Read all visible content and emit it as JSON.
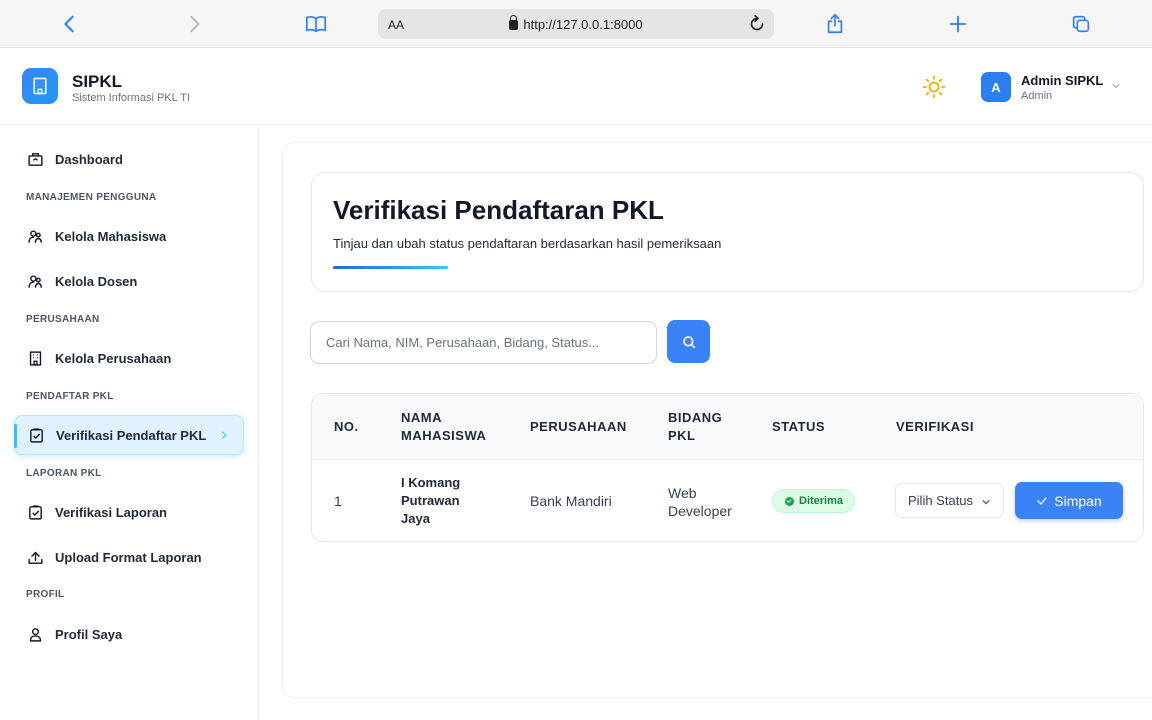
{
  "browser": {
    "aa_label": "AA",
    "url": "http://127.0.0.1:8000"
  },
  "app": {
    "name": "SIPKL",
    "subtitle": "Sistem Informasi PKL TI"
  },
  "user": {
    "initial": "A",
    "name": "Admin SIPKL",
    "role": "Admin"
  },
  "sidebar": {
    "dashboard": "Dashboard",
    "section_pengguna": "MANAJEMEN PENGGUNA",
    "mahasiswa": "Kelola Mahasiswa",
    "dosen": "Kelola Dosen",
    "section_perusahaan": "PERUSAHAAN",
    "perusahaan": "Kelola Perusahaan",
    "section_pendaftar": "PENDAFTAR PKL",
    "verifikasi_pendaftar": "Verifikasi Pendaftar PKL",
    "section_laporan": "LAPORAN PKL",
    "verifikasi_laporan": "Verifikasi Laporan",
    "upload_format": "Upload Format Laporan",
    "section_profil": "PROFIL",
    "profil": "Profil Saya"
  },
  "page": {
    "title": "Verifikasi Pendaftaran PKL",
    "subtitle": "Tinjau dan ubah status pendaftaran berdasarkan hasil pemeriksaan"
  },
  "search": {
    "placeholder": "Cari Nama, NIM, Perusahaan, Bidang, Status..."
  },
  "table": {
    "headers": {
      "no": "NO.",
      "nama_line1": "NAMA",
      "nama_line2": "MAHASISWA",
      "perusahaan": "PERUSAHAAN",
      "bidang_line1": "BIDANG",
      "bidang_line2": "PKL",
      "status": "STATUS",
      "verifikasi": "VERIFIKASI"
    },
    "rows": [
      {
        "no": "1",
        "nama_line1": "I Komang",
        "nama_line2": "Putrawan",
        "nama_line3": "Jaya",
        "perusahaan": "Bank Mandiri",
        "bidang_line1": "Web",
        "bidang_line2": "Developer",
        "status": "Diterima",
        "select_value": "Pilih Status",
        "save_label": "Simpan"
      }
    ]
  },
  "colors": {
    "accent": "#3b82f6",
    "status_success": "#16a34a",
    "active_nav_bg": "#e0f2fe"
  },
  "icons": [
    "back-icon",
    "forward-icon",
    "bookmarks-icon",
    "reload-icon",
    "share-icon",
    "new-tab-icon",
    "tabs-icon",
    "building-icon",
    "sun-icon",
    "chevron-down-icon",
    "dashboard-icon",
    "users-icon",
    "office-icon",
    "check-doc-icon",
    "upload-icon",
    "user-icon",
    "search-icon",
    "check-icon"
  ]
}
